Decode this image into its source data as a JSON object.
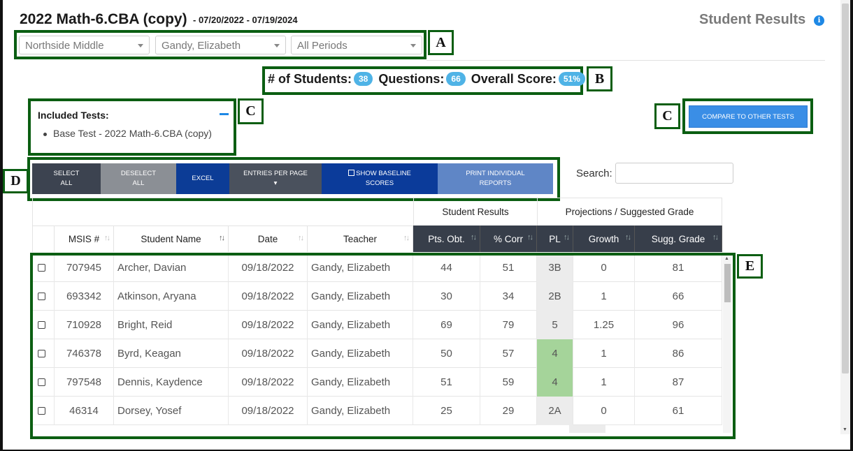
{
  "header": {
    "title": "2022 Math-6.CBA (copy)",
    "dates": "- 07/20/2022 - 07/19/2024",
    "page_title": "Student Results",
    "info_icon": "i"
  },
  "filters": {
    "school": "Northside Middle",
    "teacher": "Gandy, Elizabeth",
    "period": "All Periods"
  },
  "stats": {
    "students_label": "# of Students:",
    "students": "38",
    "questions_label": "Questions:",
    "questions": "66",
    "score_label": "Overall Score:",
    "score": "51%"
  },
  "included": {
    "title": "Included Tests:",
    "items": [
      "Base Test - 2022 Math-6.CBA (copy)"
    ]
  },
  "compare_button": "COMPARE TO OTHER TESTS",
  "toolbar": {
    "select_all_1": "SELECT",
    "select_all_2": "ALL",
    "deselect_all_1": "DESELECT",
    "deselect_all_2": "ALL",
    "excel": "EXCEL",
    "entries": "ENTRIES PER PAGE",
    "entries_caret": "▾",
    "baseline": "SHOW BASELINE",
    "baseline_2": "SCORES",
    "print_1": "PRINT INDIVIDUAL",
    "print_2": "REPORTS"
  },
  "search": {
    "label": "Search:",
    "placeholder": ""
  },
  "table": {
    "group_headers": [
      "Student Results",
      "Projections / Suggested Grade"
    ],
    "columns": [
      "MSIS #",
      "Student Name",
      "Date",
      "Teacher",
      "Pts. Obt.",
      "% Corr",
      "PL",
      "Growth",
      "Sugg. Grade"
    ],
    "rows": [
      {
        "msis": "707945",
        "name": "Archer, Davian",
        "date": "09/18/2022",
        "teacher": "Gandy, Elizabeth",
        "pts": "44",
        "corr": "51",
        "pl": "3B",
        "growth": "0",
        "grade": "81"
      },
      {
        "msis": "693342",
        "name": "Atkinson, Aryana",
        "date": "09/18/2022",
        "teacher": "Gandy, Elizabeth",
        "pts": "30",
        "corr": "34",
        "pl": "2B",
        "growth": "1",
        "grade": "66"
      },
      {
        "msis": "710928",
        "name": "Bright, Reid",
        "date": "09/18/2022",
        "teacher": "Gandy, Elizabeth",
        "pts": "69",
        "corr": "79",
        "pl": "5",
        "growth": "1.25",
        "grade": "96"
      },
      {
        "msis": "746378",
        "name": "Byrd, Keagan",
        "date": "09/18/2022",
        "teacher": "Gandy, Elizabeth",
        "pts": "50",
        "corr": "57",
        "pl": "4",
        "growth": "1",
        "grade": "86"
      },
      {
        "msis": "797548",
        "name": "Dennis, Kaydence",
        "date": "09/18/2022",
        "teacher": "Gandy, Elizabeth",
        "pts": "51",
        "corr": "59",
        "pl": "4",
        "growth": "1",
        "grade": "87"
      },
      {
        "msis": "46314",
        "name": "Dorsey, Yosef",
        "date": "09/18/2022",
        "teacher": "Gandy, Elizabeth",
        "pts": "25",
        "corr": "29",
        "pl": "2A",
        "growth": "0",
        "grade": "61"
      }
    ]
  },
  "annotations": {
    "a": "A",
    "b": "B",
    "c1": "C",
    "c2": "C",
    "d": "D",
    "e": "E"
  },
  "colors": {
    "annotation_green": "#0b5e12",
    "pill_blue": "#4fb3e6",
    "compare_blue": "#3a8ee6",
    "header_dark": "#373e4a",
    "pl_green": "#a5d49a"
  }
}
